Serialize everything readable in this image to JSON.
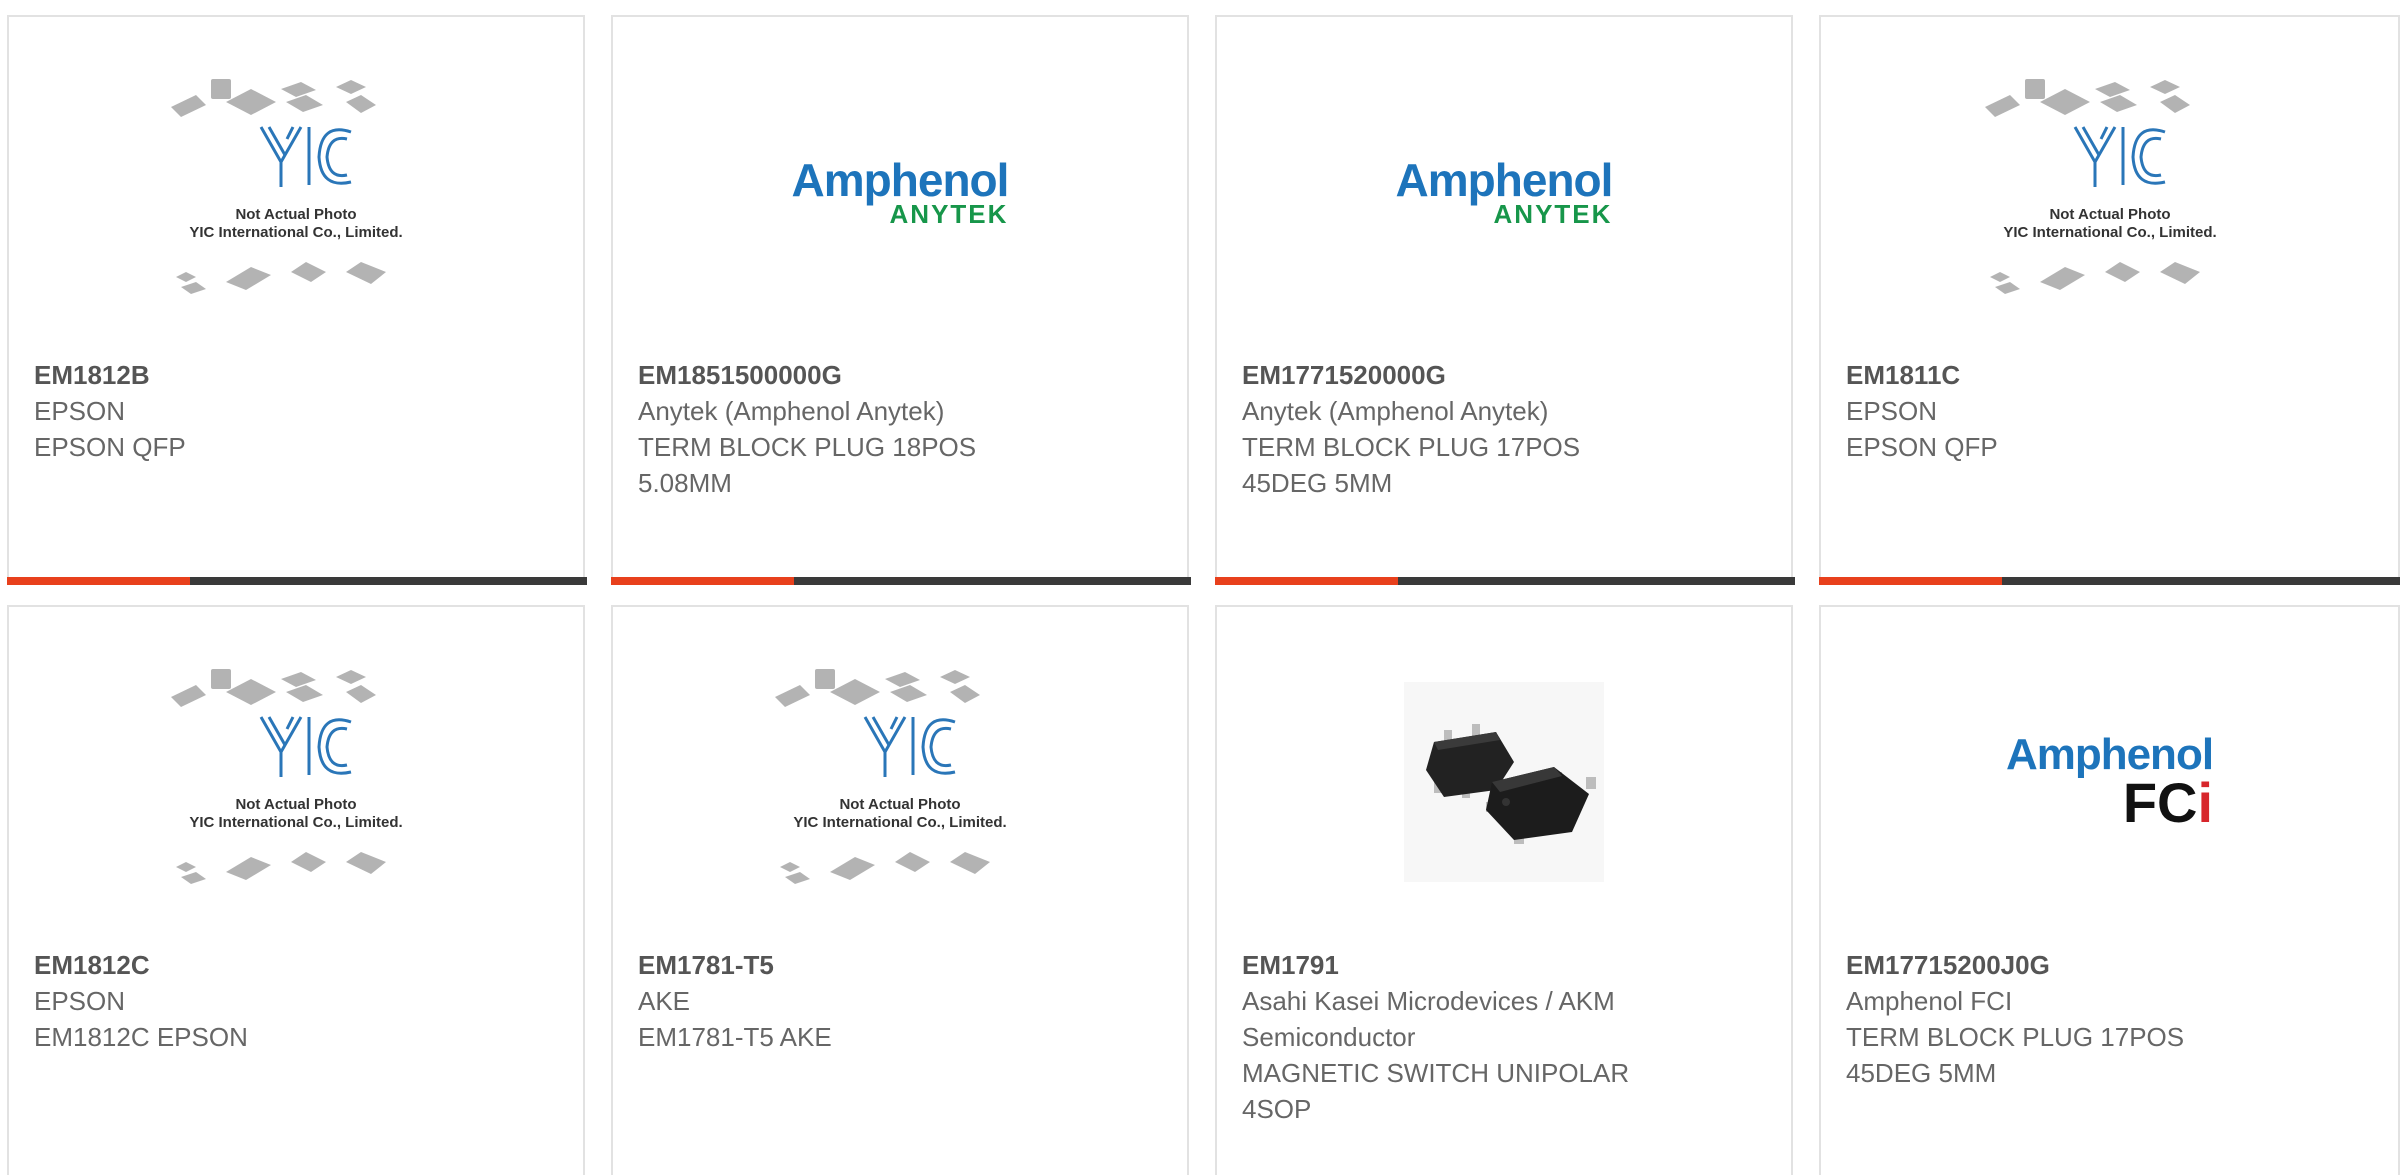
{
  "products": [
    {
      "part": "EM1812B",
      "maker": "EPSON",
      "desc": [
        "EPSON QFP"
      ],
      "image": "yic-placeholder",
      "placeholder": {
        "line1": "Not Actual Photo",
        "line2": "YIC International Co., Limited."
      }
    },
    {
      "part": "EM1851500000G",
      "maker": "Anytek (Amphenol Anytek)",
      "desc": [
        "TERM BLOCK PLUG 18POS",
        "5.08MM"
      ],
      "image": "amphenol-anytek-logo",
      "logo": {
        "top": "Amphenol",
        "bottom": "ANYTEK"
      }
    },
    {
      "part": "EM1771520000G",
      "maker": "Anytek (Amphenol Anytek)",
      "desc": [
        "TERM BLOCK PLUG 17POS",
        "45DEG 5MM"
      ],
      "image": "amphenol-anytek-logo",
      "logo": {
        "top": "Amphenol",
        "bottom": "ANYTEK"
      }
    },
    {
      "part": "EM1811C",
      "maker": "EPSON",
      "desc": [
        "EPSON QFP"
      ],
      "image": "yic-placeholder",
      "placeholder": {
        "line1": "Not Actual Photo",
        "line2": "YIC International Co., Limited."
      }
    },
    {
      "part": "EM1812C",
      "maker": "EPSON",
      "desc": [
        "EM1812C EPSON"
      ],
      "image": "yic-placeholder",
      "placeholder": {
        "line1": "Not Actual Photo",
        "line2": "YIC International Co., Limited."
      }
    },
    {
      "part": "EM1781-T5",
      "maker": "AKE",
      "desc": [
        "EM1781-T5 AKE"
      ],
      "image": "yic-placeholder",
      "placeholder": {
        "line1": "Not Actual Photo",
        "line2": "YIC International Co., Limited."
      }
    },
    {
      "part": "EM1791",
      "maker": "Asahi Kasei Microdevices / AKM",
      "maker2": "Semiconductor",
      "desc": [
        "MAGNETIC SWITCH UNIPOLAR",
        "4SOP"
      ],
      "image": "sop-chip-photo"
    },
    {
      "part": "EM17715200J0G",
      "maker": "Amphenol FCI",
      "desc": [
        "TERM BLOCK PLUG 17POS",
        "45DEG 5MM"
      ],
      "image": "amphenol-fci-logo",
      "logo": {
        "top": "Amphenol",
        "bottom_a": "FC",
        "bottom_b": "i"
      }
    }
  ],
  "colors": {
    "accent": "#e8401c",
    "bar": "#3a3a3a",
    "amphenol_blue": "#1d74bb",
    "anytek_green": "#17964a"
  }
}
